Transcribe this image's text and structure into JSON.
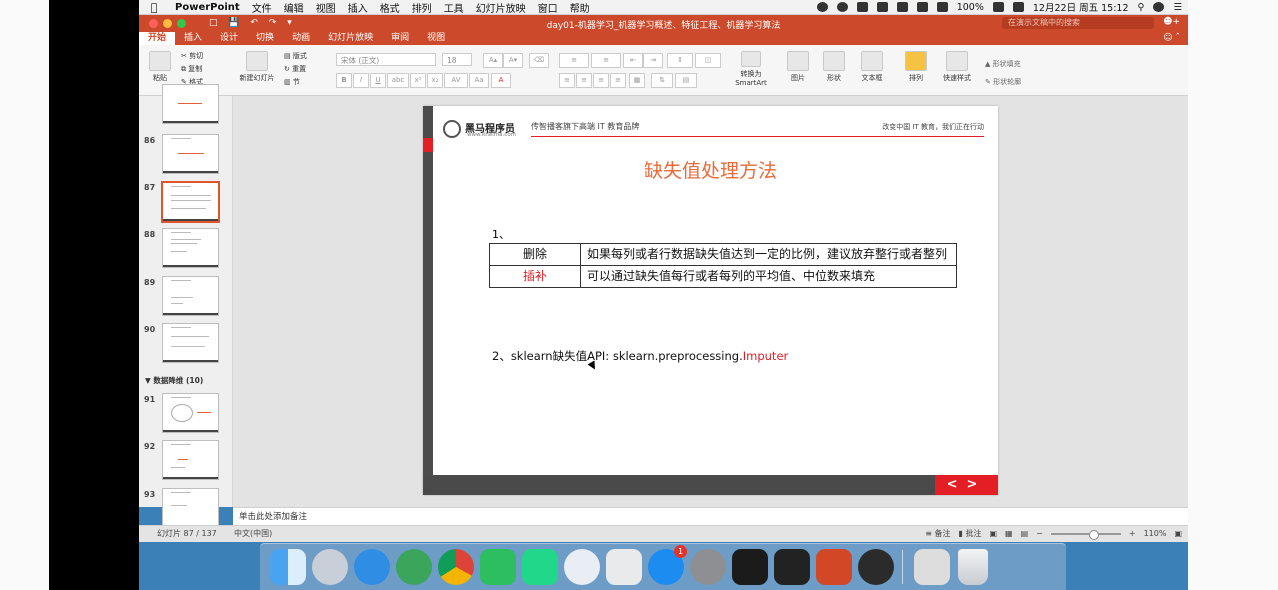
{
  "menubar": {
    "app": "PowerPoint",
    "items": [
      "文件",
      "编辑",
      "视图",
      "插入",
      "格式",
      "排列",
      "工具",
      "幻灯片放映",
      "窗口",
      "帮助"
    ],
    "battery": "100%",
    "clock": "12月22日 周五 15:12"
  },
  "window": {
    "title": "day01-机器学习_机器学习概述、特征工程、机器学习算法",
    "search_placeholder": "在演示文稿中的搜索"
  },
  "ribbon_tabs": [
    "开始",
    "插入",
    "设计",
    "切换",
    "动画",
    "幻灯片放映",
    "审阅",
    "视图"
  ],
  "ribbon": {
    "paste": "粘贴",
    "cut": "剪切",
    "copy": "复制",
    "format": "格式",
    "new_slide": "新建幻灯片",
    "layout": "版式",
    "reset": "重置",
    "section": "节",
    "font": "宋体 (正文)",
    "size": "18",
    "convert_smartart": "转换为 SmartArt",
    "picture": "图片",
    "shapes": "形状",
    "textbox": "文本框",
    "arrange": "排列",
    "quick_styles": "快速样式",
    "shape_fill": "形状填充",
    "shape_outline": "形状轮廓"
  },
  "thumbnails": {
    "section_label": "数据降维 (10)",
    "slides": [
      "86",
      "87",
      "88",
      "89",
      "90",
      "91",
      "92",
      "93"
    ],
    "selected": "87"
  },
  "slide": {
    "brand": "黑马程序员",
    "brand_url": "www.itheima.com",
    "tagline": "传智播客旗下高端 IT 教育品牌",
    "slogan": "改变中国 IT 教育，我们正在行动",
    "title": "缺失值处理方法",
    "section1": "1、",
    "table": [
      {
        "key": "删除",
        "desc": "如果每列或者行数据缺失值达到一定的比例，建议放弃整行或者整列"
      },
      {
        "key": "插补",
        "desc": "可以通过缺失值每行或者每列的平均值、中位数来填充"
      }
    ],
    "section2_prefix": "2、sklearn缺失值API:  sklearn.preprocessing.",
    "section2_class": "Imputer",
    "nav_prev": "<",
    "nav_next": ">"
  },
  "notes_placeholder": "单击此处添加备注",
  "status": {
    "slide_counter": "幻灯片 87 / 137",
    "language": "中文(中国)",
    "notes_label": "备注",
    "comments_label": "批注",
    "zoom": "110%"
  },
  "dock": {
    "apps": [
      "finder-icon",
      "launchpad-icon",
      "safari-icon",
      "atom-icon",
      "chrome-icon",
      "evernote-icon",
      "pycharm-icon",
      "qq-icon",
      "keynote-icon",
      "appstore-icon",
      "system-preferences-icon",
      "terminal-icon",
      "activity-monitor-icon",
      "powerpoint-icon",
      "obs-icon",
      "preview-icon",
      "trash-icon"
    ],
    "appstore_badge": "1"
  }
}
